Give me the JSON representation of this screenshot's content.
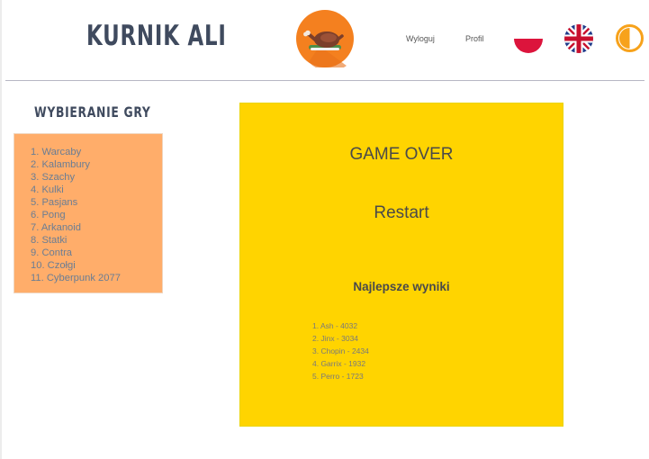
{
  "header": {
    "site_title": "Kurnik Ali",
    "logo_icon": "roast-chicken-logo-icon",
    "nav": {
      "logout_label": "Wyloguj",
      "profile_label": "Profil"
    },
    "languages": [
      {
        "code": "pl",
        "icon": "poland-flag-icon"
      },
      {
        "code": "en",
        "icon": "uk-flag-icon"
      }
    ],
    "theme_toggle_icon": "contrast-toggle-icon"
  },
  "sidebar": {
    "title": "Wybieranie gry",
    "games": [
      "1. Warcaby",
      "2. Kalambury",
      "3. Szachy",
      "4. Kulki",
      "5. Pasjans",
      "6. Pong",
      "7. Arkanoid",
      "8. Statki",
      "9. Contra",
      "10. Czołgi",
      "11. Cyberpunk 2077"
    ]
  },
  "game": {
    "status": "GAME OVER",
    "restart_label": "Restart",
    "scores_title": "Najlepsze wyniki",
    "scores": [
      "1. Ash - 4032",
      "2. Jinx - 3034",
      "3. Chopin - 2434",
      "4. Garrix - 1932",
      "5. Perro - 1723"
    ]
  },
  "colors": {
    "title": "#3f4a5e",
    "sidebar_box": "#ffad6a",
    "game_panel": "#ffd400",
    "list_text": "#6a7d94",
    "theme_toggle": "#f7a21b"
  }
}
